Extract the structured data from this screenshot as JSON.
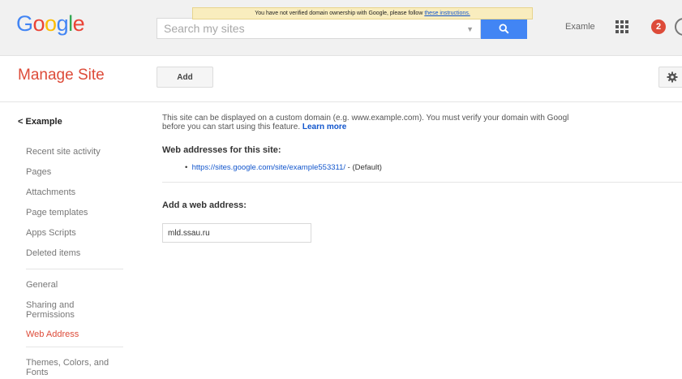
{
  "header": {
    "logo_letters": [
      {
        "char": "G",
        "color": "#4285f4"
      },
      {
        "char": "o",
        "color": "#ea4335"
      },
      {
        "char": "o",
        "color": "#fbbc05"
      },
      {
        "char": "g",
        "color": "#4285f4"
      },
      {
        "char": "l",
        "color": "#34a853"
      },
      {
        "char": "e",
        "color": "#ea4335"
      }
    ],
    "search_placeholder": "Search my sites",
    "search_button_icon": "search-icon",
    "notice_text": "You have not verified domain ownership with Google, please follow",
    "notice_link": "these instructions.",
    "account_label": "Examle",
    "apps_icon": "apps-grid-icon",
    "notification_count": "2"
  },
  "manage": {
    "title": "Manage Site",
    "add_label": "Add",
    "settings_icon": "gear-icon"
  },
  "sidebar": {
    "back_label": "< Example",
    "group1": [
      "Recent site activity",
      "Pages",
      "Attachments",
      "Page templates",
      "Apps Scripts",
      "Deleted items"
    ],
    "group2": [
      "General",
      "Sharing and Permissions",
      "Web Address",
      "Themes, Colors, and Fonts"
    ],
    "active_item": "Web Address"
  },
  "main": {
    "description_line1": "This site can be displayed on a custom domain (e.g. www.example.com). You must verify your domain with Googl",
    "description_line2": "before you can start using this feature.",
    "learn_more": "Learn more",
    "web_addresses_heading": "Web addresses for this site:",
    "site_url": "https://sites.google.com/site/example553311/",
    "site_url_suffix": " - (Default)",
    "add_address_heading": "Add a web address:",
    "address_value": "mld.ssau.ru"
  },
  "colors": {
    "accent_red": "#dd4b39",
    "link_blue": "#1155cc",
    "search_blue": "#4285f4",
    "notice_bg": "#f9edbe"
  }
}
